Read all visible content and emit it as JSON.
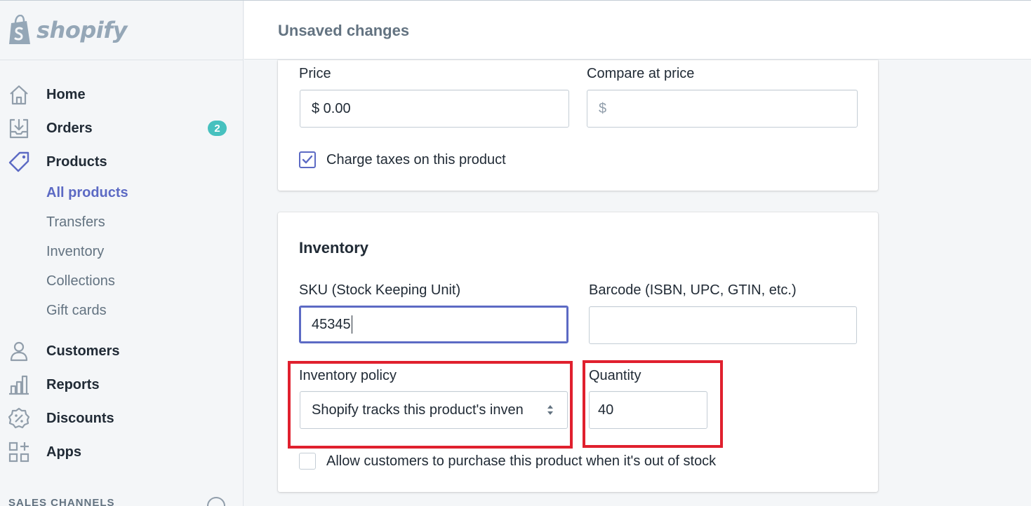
{
  "brand": {
    "name": "shopify"
  },
  "topbar": {
    "title": "Unsaved changes"
  },
  "sidebar": {
    "items": [
      {
        "label": "Home",
        "icon": "home-icon"
      },
      {
        "label": "Orders",
        "icon": "orders-icon",
        "badge": "2"
      },
      {
        "label": "Products",
        "icon": "tag-icon"
      },
      {
        "label": "Customers",
        "icon": "person-icon"
      },
      {
        "label": "Reports",
        "icon": "bar-chart-icon"
      },
      {
        "label": "Discounts",
        "icon": "discount-icon"
      },
      {
        "label": "Apps",
        "icon": "apps-icon"
      }
    ],
    "product_subitems": [
      {
        "label": "All products",
        "active": true
      },
      {
        "label": "Transfers"
      },
      {
        "label": "Inventory"
      },
      {
        "label": "Collections"
      },
      {
        "label": "Gift cards"
      }
    ],
    "sales_channels_label": "SALES CHANNELS"
  },
  "pricing": {
    "price_label": "Price",
    "price_value": "$ 0.00",
    "compare_label": "Compare at price",
    "compare_placeholder": "$",
    "charge_taxes_label": "Charge taxes on this product",
    "charge_taxes_checked": true
  },
  "inventory": {
    "title": "Inventory",
    "sku_label": "SKU (Stock Keeping Unit)",
    "sku_value": "45345",
    "barcode_label": "Barcode (ISBN, UPC, GTIN, etc.)",
    "barcode_value": "",
    "policy_label": "Inventory policy",
    "policy_value": "Shopify tracks this product's inven",
    "quantity_label": "Quantity",
    "quantity_value": "40",
    "allow_oos_label": "Allow customers to purchase this product when it's out of stock",
    "allow_oos_checked": false
  },
  "colors": {
    "accent": "#5c6ac4",
    "badge": "#47c1bf",
    "highlight": "#e0202e",
    "sidebar_bg": "#f4f6f8"
  }
}
